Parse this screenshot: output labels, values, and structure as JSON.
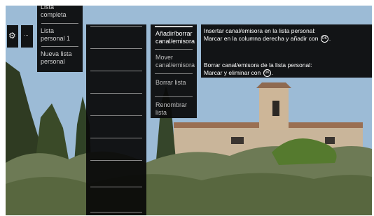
{
  "left_icons": {
    "settings_icon": "gear-icon",
    "more_label": "..."
  },
  "lists": [
    {
      "label": "Lista completa"
    },
    {
      "label": "Lista personal 1"
    },
    {
      "label": "Nueva lista personal"
    }
  ],
  "context_menu": [
    {
      "label": "Añadir/borrar canal/emisora",
      "active": true
    },
    {
      "label": "Mover canal/emisora",
      "active": false
    },
    {
      "label": "Borrar lista",
      "active": false
    },
    {
      "label": "Renombrar lista",
      "active": false
    }
  ],
  "info": {
    "insert_title": "Insertar canal/emisora en la lista personal:",
    "insert_text": "Marcar en la columna derecha y añadir con",
    "delete_title": "Borrar canal/emisora de la lista personal:",
    "delete_text": "Marcar y eliminar con",
    "ok_label": "OK"
  },
  "colors": {
    "panel": "#0a0a0a",
    "text": "#d9d9d9",
    "separator": "#8a8a8a"
  }
}
